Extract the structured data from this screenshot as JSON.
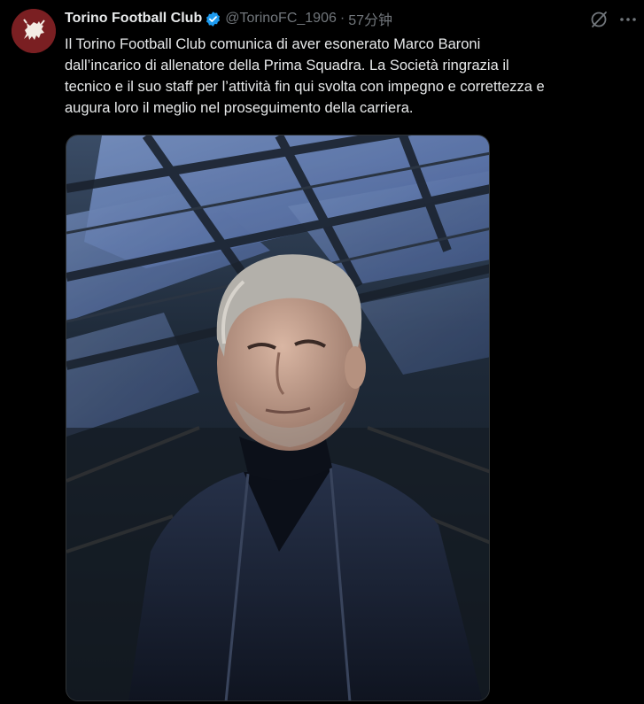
{
  "tweet": {
    "display_name": "Torino Football Club",
    "handle": "@TorinoFC_1906",
    "separator": "·",
    "time": "57分钟",
    "text": "Il Torino Football Club comunica di aver esonerato Marco Baroni\ndall’incarico di allenatore della Prima Squadra. La Società ringrazia il\ntecnico e il suo staff per l’attività fin qui svolta con impegno e correttezza e\naugura loro il meglio nel proseguimento della carriera.",
    "media_alt": "photo-of-coach-in-stadium"
  },
  "icons": {
    "avatar": "torino-bull-logo",
    "verified": "verified-badge-icon",
    "grok": "grok-icon",
    "more": "more-icon"
  },
  "colors": {
    "background": "#000000",
    "text": "#e7e9ea",
    "muted": "#71767b",
    "verified": "#1d9bf0",
    "avatar_bg": "#7a1f22"
  }
}
